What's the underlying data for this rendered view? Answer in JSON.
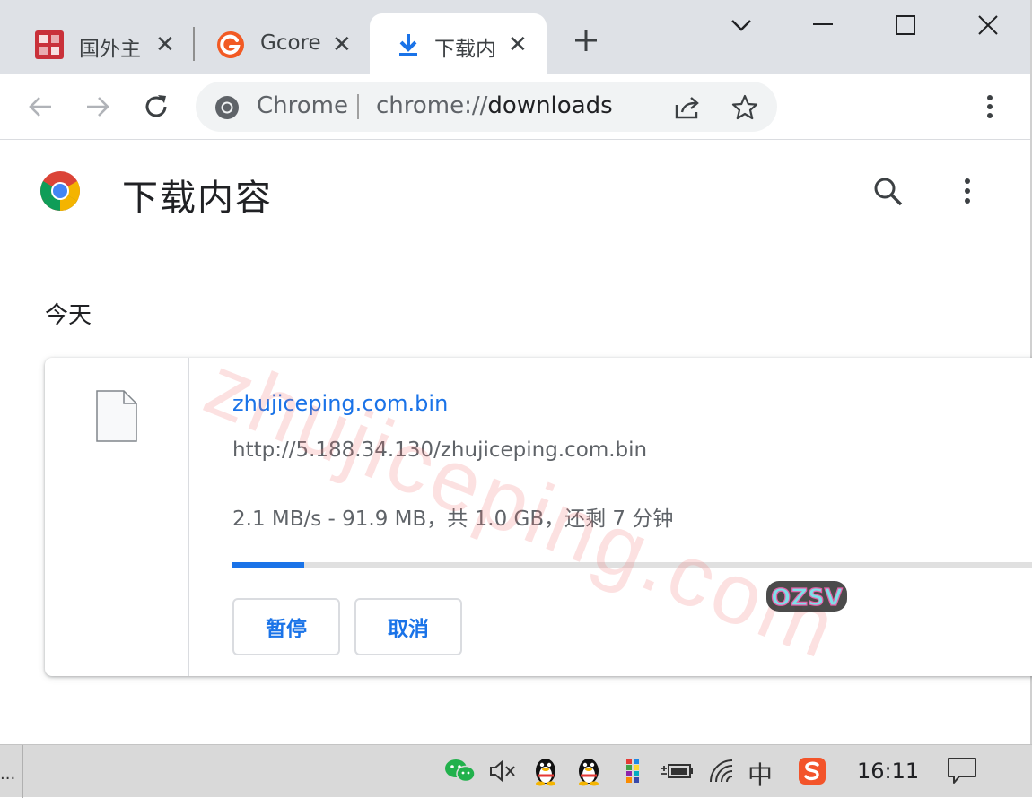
{
  "tabs": [
    {
      "title": "国外主",
      "favicon": "site-favicon-red",
      "close": "✕"
    },
    {
      "title": "Gcore",
      "favicon": "gcore-favicon",
      "close": "✕"
    },
    {
      "title": "下载内",
      "favicon": "download-icon",
      "close": "✕",
      "active": true
    }
  ],
  "omnibox": {
    "chip": "Chrome",
    "url_scheme": "chrome://",
    "url_host": "downloads"
  },
  "page": {
    "title": "下载内容",
    "date_group": "今天"
  },
  "download": {
    "file_name": "zhujiceping.com.bin",
    "url": "http://5.188.34.130/zhujiceping.com.bin",
    "status": "2.1 MB/s - 91.9 MB，共 1.0 GB，还剩 7 分钟",
    "progress_fraction": 0.089,
    "pause_label": "暂停",
    "cancel_label": "取消"
  },
  "watermark": "zhujiceping.com",
  "badge_text": "OZSV",
  "taskbar": {
    "dots": "...",
    "ime": "中",
    "clock": "16:11"
  },
  "colors": {
    "accent": "#1a73e8",
    "tabstrip": "#dee1e6",
    "taskbar": "#d9d9d9"
  }
}
